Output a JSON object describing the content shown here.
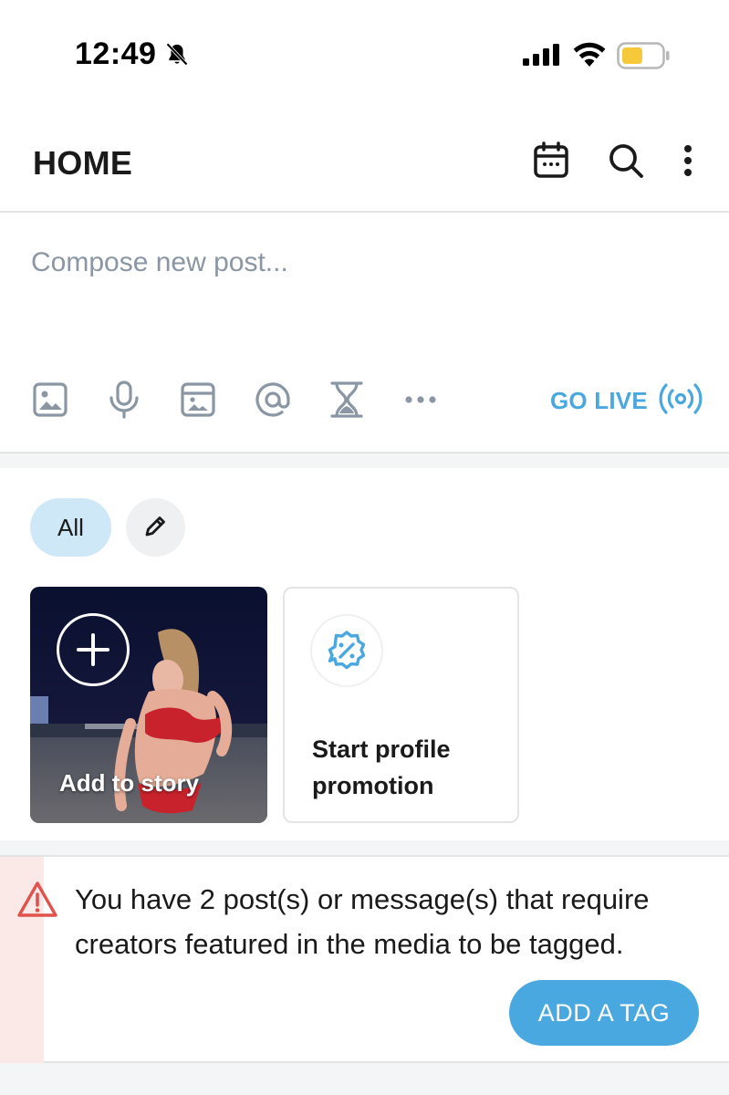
{
  "status_bar": {
    "time": "12:49",
    "icons": [
      "bell-slash-icon",
      "cellular-signal-icon",
      "wifi-icon",
      "battery-icon"
    ],
    "battery_color": "#f5c93a"
  },
  "header": {
    "title": "HOME",
    "icons": [
      "calendar-icon",
      "search-icon",
      "more-vertical-icon"
    ]
  },
  "composer": {
    "placeholder": "Compose new post...",
    "tools": [
      "image-icon",
      "microphone-icon",
      "vault-icon",
      "mention-icon",
      "hourglass-icon",
      "more-horizontal-icon"
    ],
    "go_live_label": "GO LIVE",
    "go_live_icon": "live-broadcast-icon"
  },
  "stories": {
    "filter_all_label": "All",
    "edit_icon": "pencil-icon",
    "add_story_label": "Add to story",
    "promo_label": "Start profile promotion",
    "promo_icon": "discount-badge-icon"
  },
  "alert": {
    "message": "You have 2 post(s) or message(s) that require creators featured in the media to be tagged.",
    "button_label": "ADD A TAG",
    "icon": "warning-icon"
  },
  "colors": {
    "accent": "#4aa8e0",
    "chip_active": "#cfe8f8",
    "warning": "#e0524b",
    "warning_bg": "#fbe9e8",
    "muted": "#8a96a3"
  }
}
